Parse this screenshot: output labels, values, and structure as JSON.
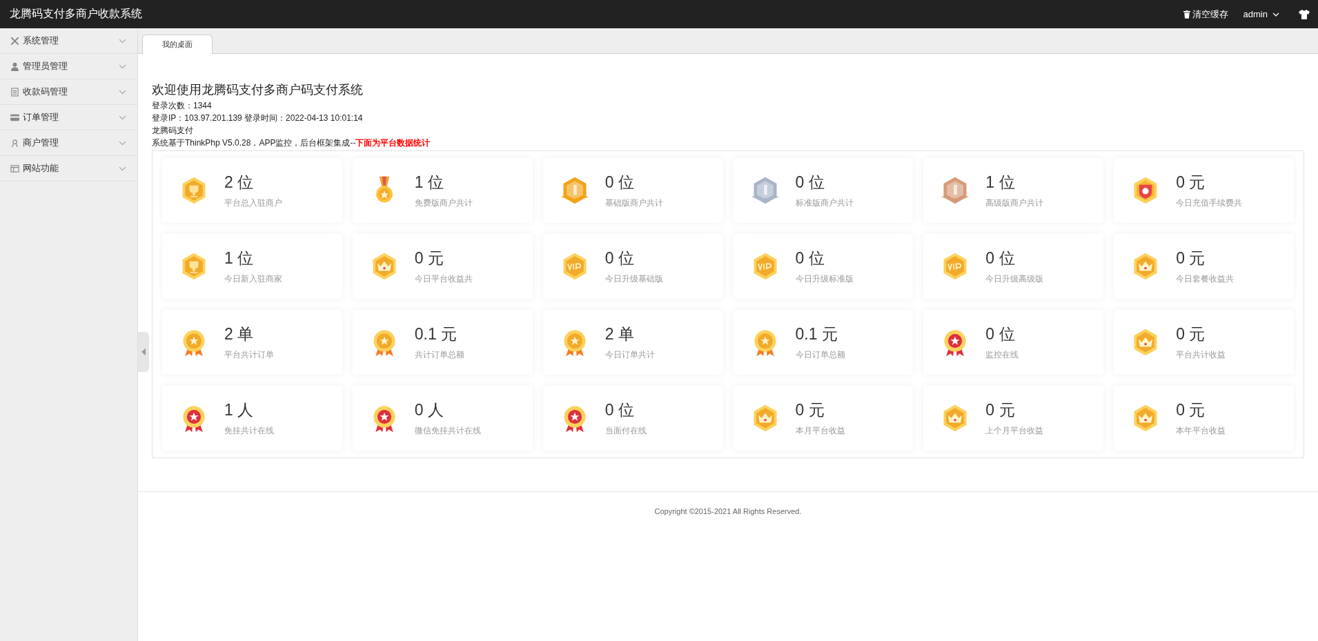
{
  "header": {
    "title": "龙腾码支付多商户收款系统",
    "clear_cache": "清空缓存",
    "user": "admin"
  },
  "sidebar": {
    "items": [
      {
        "kind": "tools",
        "label": "系统管理",
        "expanded": false
      },
      {
        "kind": "user",
        "label": "管理员管理",
        "expanded": false
      },
      {
        "kind": "list",
        "label": "收款码管理",
        "expanded": false
      },
      {
        "kind": "card",
        "label": "订单管理",
        "expanded": false
      },
      {
        "kind": "merchant",
        "label": "商户管理",
        "expanded": false
      },
      {
        "kind": "window",
        "label": "网站功能",
        "expanded": false
      }
    ]
  },
  "tabs": [
    {
      "label": "我的桌面",
      "selected": true
    }
  ],
  "welcome": {
    "title": "欢迎使用龙腾码支付多商户码支付系统",
    "lines": [
      "登录次数：1344",
      "登录IP：103.97.201.139 登录时间：2022-04-13 10:01:14",
      "龙腾码支付",
      "系统基于ThinkPhp V5.0.28，APP监控，后台框架集成--**下面为平台数据统计**"
    ]
  },
  "stats": [
    {
      "kind": "trophy",
      "value": "2 位",
      "label": "平台总入驻商户"
    },
    {
      "kind": "medal",
      "value": "1 位",
      "label": "免费版商户共计"
    },
    {
      "kind": "rank",
      "color": "#f2a319",
      "value": "0 位",
      "label": "基础版商户共计"
    },
    {
      "kind": "rank",
      "color": "#a9b4c8",
      "value": "0 位",
      "label": "标准版商户共计"
    },
    {
      "kind": "rank",
      "color": "#d79a78",
      "value": "1 位",
      "label": "高级版商户共计"
    },
    {
      "kind": "shield",
      "value": "0 元",
      "label": "今日充值手续费共"
    },
    {
      "kind": "trophy",
      "value": "1 位",
      "label": "今日新入驻商家"
    },
    {
      "kind": "crown",
      "value": "0 元",
      "label": "今日平台收益共"
    },
    {
      "kind": "vip",
      "value": "0 位",
      "label": "今日升级基础版"
    },
    {
      "kind": "vip",
      "value": "0 位",
      "label": "今日升级标准版"
    },
    {
      "kind": "vip",
      "value": "0 位",
      "label": "今日升级高级版"
    },
    {
      "kind": "crown",
      "value": "0 元",
      "label": "今日套餐收益共"
    },
    {
      "kind": "rosette",
      "value": "2 单",
      "label": "平台共计订单"
    },
    {
      "kind": "rosette",
      "value": "0.1 元",
      "label": "共计订单总额"
    },
    {
      "kind": "rosette",
      "value": "2 单",
      "label": "今日订单共计"
    },
    {
      "kind": "rosette",
      "value": "0.1 元",
      "label": "今日订单总额"
    },
    {
      "kind": "red-rosette",
      "value": "0 位",
      "label": "监控在线"
    },
    {
      "kind": "crown",
      "value": "0 元",
      "label": "平台共计收益"
    },
    {
      "kind": "red-rosette",
      "value": "1 人",
      "label": "免挂共计在线"
    },
    {
      "kind": "red-rosette",
      "value": "0 人",
      "label": "微信免挂共计在线"
    },
    {
      "kind": "red-rosette",
      "value": "0 位",
      "label": "当面付在线"
    },
    {
      "kind": "crown",
      "value": "0 元",
      "label": "本月平台收益"
    },
    {
      "kind": "crown",
      "value": "0 元",
      "label": "上个月平台收益"
    },
    {
      "kind": "crown",
      "value": "0 元",
      "label": "本年平台收益"
    }
  ],
  "footer": "Copyright ©2015-2021 All Rights Reserved."
}
